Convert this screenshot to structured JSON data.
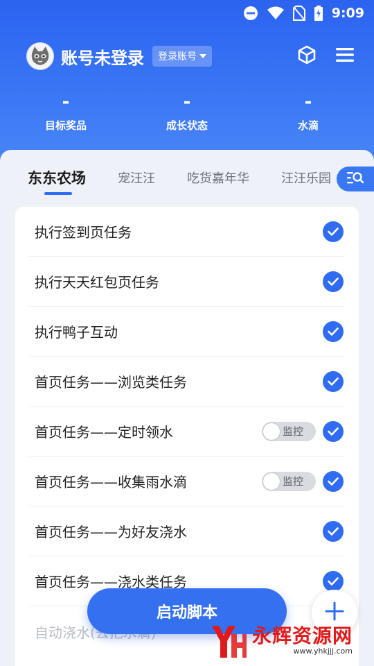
{
  "status_bar": {
    "time": "9:09",
    "icons": [
      "dnd-icon",
      "wifi-icon",
      "no-sim-icon",
      "battery-charging-icon"
    ]
  },
  "account": {
    "name": "账号未登录",
    "login_label": "登录账号",
    "avatar_icon": "cat-avatar-icon"
  },
  "header_icons": [
    "cube-icon",
    "menu-icon"
  ],
  "stats": [
    {
      "value": "-",
      "label": "目标奖品"
    },
    {
      "value": "-",
      "label": "成长状态"
    },
    {
      "value": "-",
      "label": "水滴"
    }
  ],
  "tabs": [
    "东东农场",
    "宠汪汪",
    "吃货嘉年华",
    "汪汪乐园"
  ],
  "active_tab": "东东农场",
  "tasks": [
    {
      "label": "执行签到页任务",
      "checked": true,
      "monitor": false
    },
    {
      "label": "执行天天红包页任务",
      "checked": true,
      "monitor": false
    },
    {
      "label": "执行鸭子互动",
      "checked": true,
      "monitor": false
    },
    {
      "label": "首页任务——浏览类任务",
      "checked": true,
      "monitor": false
    },
    {
      "label": "首页任务——定时领水",
      "checked": true,
      "monitor": true,
      "monitor_label": "监控"
    },
    {
      "label": "首页任务——收集雨水滴",
      "checked": true,
      "monitor": true,
      "monitor_label": "监控"
    },
    {
      "label": "首页任务——为好友浇水",
      "checked": true,
      "monitor": false
    },
    {
      "label": "首页任务——浇水类任务",
      "checked": true,
      "monitor": false
    },
    {
      "label": "自动浇水(去把水滴)",
      "checked": false,
      "monitor": false
    }
  ],
  "start_button": "启动脚本",
  "watermark": {
    "title": "永辉资源网",
    "url": "www.yhkjjj.com"
  },
  "colors": {
    "primary": "#2f6cf2",
    "panel_bg": "#eef2f8",
    "watermark_red": "#e01a1a"
  }
}
